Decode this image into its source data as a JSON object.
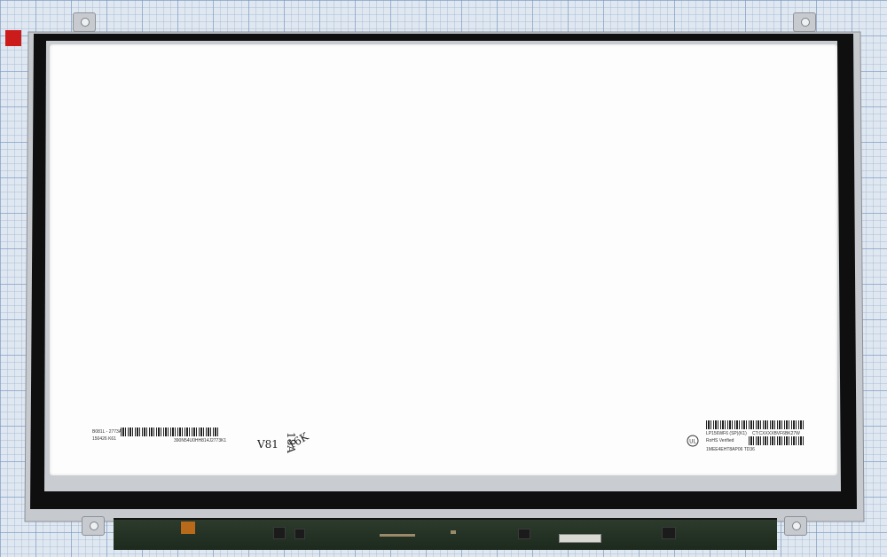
{
  "panel_labels": {
    "left_line1": "B081L - 2773A",
    "left_line2": "150426  K61",
    "left_serial": "390N54U0HH814J2773K1",
    "ink_mark_1": "V81",
    "ink_mark_2": "18A",
    "ink_mark_3": "16K",
    "right_model": "LP156WF6  (SP)(K1)",
    "right_ct": "CT:CXXXXBVF6BK27W",
    "right_rohs": "RoHS Verified",
    "right_bottom": "1MEE4EHT8AP06  TD36"
  },
  "colors": {
    "bezel": "#111111",
    "metal": "#c9ccd0",
    "screen": "#fdfdfd",
    "pcb": "#24331f",
    "tab": "#cc1b1b"
  }
}
